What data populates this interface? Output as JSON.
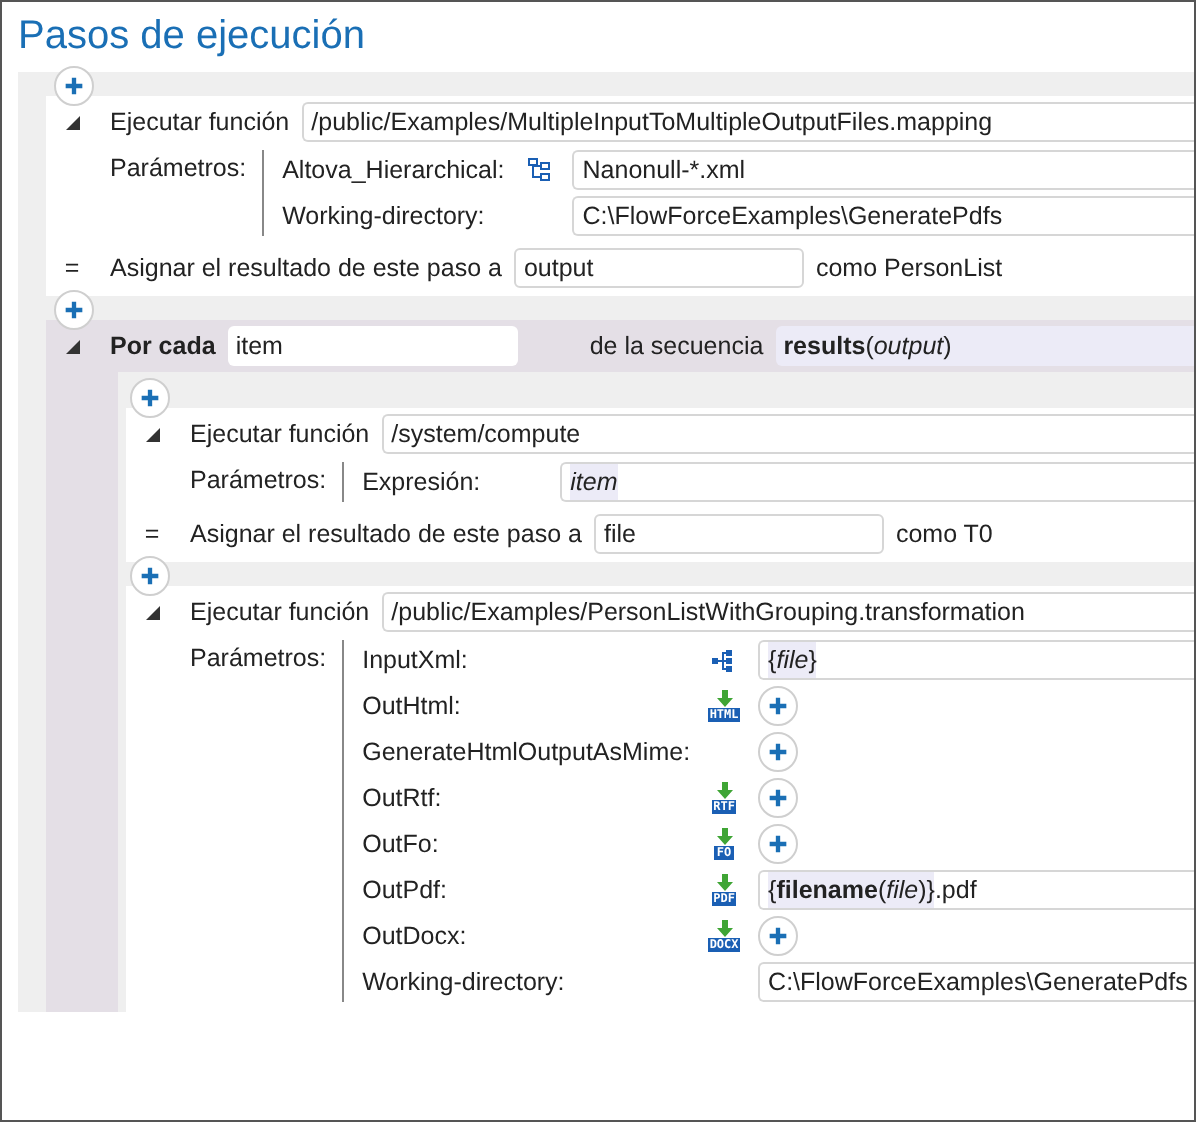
{
  "title": "Pasos de ejecución",
  "steps": [
    {
      "kind": "execute",
      "expanded": true,
      "label": "Ejecutar función",
      "path": "/public/Examples/MultipleInputToMultipleOutputFiles.mapping",
      "params_label": "Parámetros:",
      "params": [
        {
          "name": "Altova_Hierarchical:",
          "kind": "tree",
          "parts": [
            {
              "kind": "text",
              "text": "Nanonull-*.xml"
            }
          ]
        },
        {
          "name": "Working-directory:",
          "parts": [
            {
              "kind": "text",
              "text": "C:\\FlowForceExamples\\GeneratePdfs"
            }
          ]
        }
      ],
      "assign": {
        "sign": "=",
        "label": "Asignar el resultado de este paso a",
        "value": "output",
        "type_text": "como PersonList"
      }
    },
    {
      "kind": "foreach",
      "expanded": true,
      "label": "Por cada",
      "var": "item",
      "seq_label": "de la secuencia",
      "seq": "**results**(*output*)",
      "steps": [
        {
          "kind": "execute",
          "expanded": true,
          "label": "Ejecutar función",
          "path": "/system/compute",
          "params_label": "Parámetros:",
          "params": [
            {
              "name": "Expresión:",
              "parts": [
                {
                  "kind": "expr",
                  "text": "*item*"
                }
              ]
            }
          ],
          "assign": {
            "sign": "=",
            "label": "Asignar el resultado de este paso a",
            "value": "file",
            "type_text": "como T0"
          }
        },
        {
          "kind": "execute",
          "expanded": true,
          "label": "Ejecutar función",
          "path": "/public/Examples/PersonListWithGrouping.transformation",
          "params_label": "Parámetros:",
          "params": [
            {
              "name": "InputXml:",
              "kind": "input",
              "parts": [
                {
                  "kind": "expr",
                  "text": "{*file*}"
                }
              ]
            },
            {
              "name": "OutHtml:",
              "kind": "output",
              "badge": "HTML",
              "parts": [
                {
                  "kind": "add"
                }
              ]
            },
            {
              "name": "GenerateHtmlOutputAsMime:",
              "parts": [
                {
                  "kind": "add"
                }
              ]
            },
            {
              "name": "OutRtf:",
              "kind": "output",
              "badge": "RTF",
              "parts": [
                {
                  "kind": "add"
                }
              ]
            },
            {
              "name": "OutFo:",
              "kind": "output",
              "badge": "FO",
              "parts": [
                {
                  "kind": "add"
                }
              ]
            },
            {
              "name": "OutPdf:",
              "kind": "output",
              "badge": "PDF",
              "parts": [
                {
                  "kind": "expr",
                  "text": "{**filename**(*file*)}"
                },
                {
                  "kind": "text",
                  "text": ".pdf"
                }
              ]
            },
            {
              "name": "OutDocx:",
              "kind": "output",
              "badge": "DOCX",
              "parts": [
                {
                  "kind": "add"
                }
              ]
            },
            {
              "name": "Working-directory:",
              "parts": [
                {
                  "kind": "text",
                  "text": "C:\\FlowForceExamples\\GeneratePdfs"
                }
              ]
            }
          ]
        }
      ]
    }
  ]
}
